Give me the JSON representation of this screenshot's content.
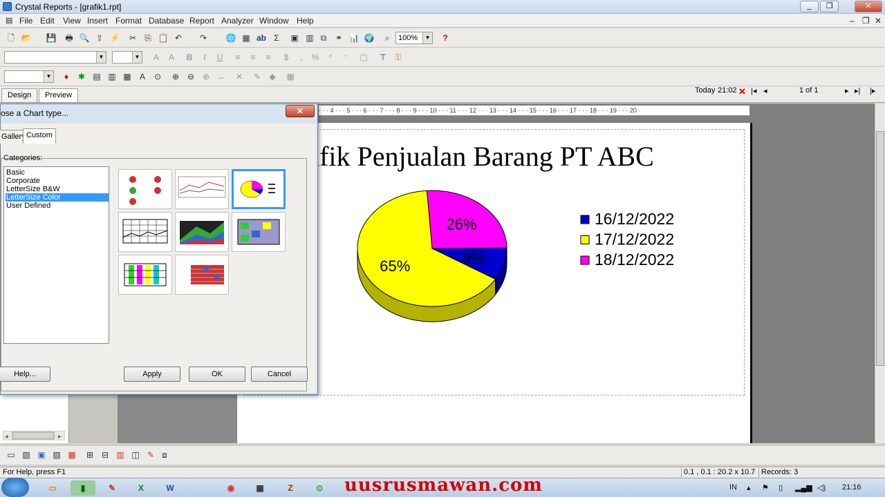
{
  "window": {
    "title": "Crystal Reports - [grafik1.rpt]",
    "min": "_",
    "restore": "❐",
    "close": "✕"
  },
  "menu": [
    "File",
    "Edit",
    "View",
    "Insert",
    "Format",
    "Database",
    "Report",
    "Analyzer",
    "Window",
    "Help"
  ],
  "toolbar": {
    "zoom": "100%"
  },
  "tabs": {
    "design": "Design",
    "preview": "Preview"
  },
  "nav": {
    "today_label": "Today",
    "time": "21:02",
    "pages": "1 of 1"
  },
  "ruler": "· · · 4 · · · 5 · · · 6 · · · 7 · · · 8 · · · 9 · · · 10 · · · 11 · · · 12 · · · 13 · · · 14 · · · 15 · · · 16 · · · 17 · · · 18 · · · 19 · · · 20 ·",
  "dialog": {
    "title": "ose a Chart type...",
    "tab_gallery": "Gallery",
    "tab_custom": "Custom",
    "categories_label": "Categories:",
    "categories": [
      "Basic",
      "Corporate",
      "LetterSize B&W",
      "LetterSize Color",
      "User Defined"
    ],
    "selected_category": "LetterSize Color",
    "help": "Help...",
    "apply": "Apply",
    "ok": "OK",
    "cancel": "Cancel"
  },
  "chart_data": {
    "type": "pie",
    "title": "rafik Penjualan Barang PT ABC",
    "series": [
      {
        "name": "16/12/2022",
        "value": 9,
        "label": "9%",
        "color": "#0000cc"
      },
      {
        "name": "17/12/2022",
        "value": 65,
        "label": "65%",
        "color": "#ffff00"
      },
      {
        "name": "18/12/2022",
        "value": 26,
        "label": "26%",
        "color": "#ff00ff"
      }
    ],
    "legend": "right"
  },
  "status": {
    "help": "For Help, press F1",
    "coords": "0.1 , 0.1 : 20.2 x 10.7",
    "records": "Records: 3"
  },
  "taskbar": {
    "watermark": "uusrusmawan.com",
    "lang": "IN",
    "time": "21:16"
  }
}
